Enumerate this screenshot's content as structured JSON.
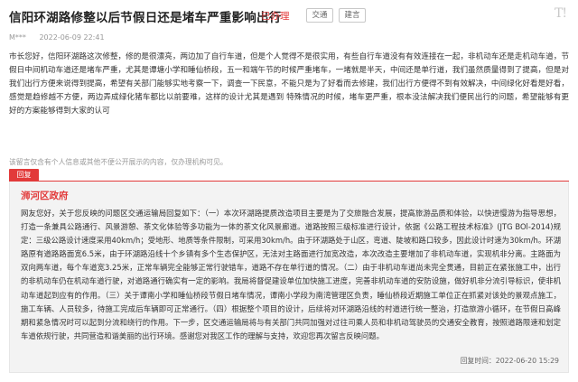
{
  "header": {
    "title": "信阳环湖路修整以后节假日还是堵车严重影响出行",
    "status": "已办理",
    "tags": [
      "交通",
      "建言"
    ],
    "logo": "T!"
  },
  "meta": {
    "user": "M***",
    "date": "2022-06-09 22:41"
  },
  "message": "市长您好，信阳环湖路这次修整，修的是很漂亮，两边加了自行车道，但是个人觉得不是很实用，有些自行车道没有有效连接在一起，非机动车还是走机动车道，节假日中间机动车道还是堵车严重，尤其是谭塘小学和睡仙桥段，五一和端午节的时候严重堵车，一堵就是半天，中间还是单行道，我们虽然质量得到了提高，但是对我们出行方便来说得到提高，希望有关部门能够实地考察一下，调查一下民意，不能只是为了好看而去修建，我们出行方便得不到有效解决，中间绿化好看是好看，感觉是趋修越不方便，两边弄成绿化猪车都比以前要难，这样的设计尤其是遇到 特殊情况的时候，堵车更严重，根本没法解决我们便民出行的问题，希望能够有更好的方案能够得到大家的认可",
  "notice": "该留言仅含有个人信息或其他不便公开展示的内容，仅办理机构可见。",
  "reply": {
    "tab_label": "回复",
    "org": "浉河区政府",
    "text": "网友您好，关于您反映的问题区交通运输局回复如下：（一）本次环湖路提质改造项目主要是为了交旅融合发展，提高旅游品质和体验，以快进慢游为指导思想，打造一条兼具公路通行、风景游憩、茶文化体验等多功能为一体的茶文化风景廊道。道路按照三级标准进行设计，依据《公路工程技术标准》(JTG BOl-2014)规定：三级公路设计速度采用40km/h；受地形、地质等条件限制，可采用30km/h。由于环湖路处于山区，弯道、陡坡和路口较多，因此设计时速为30km/h。环湖路原有道路路面宽6.5米，由于环湖路沿线十个乡镇有多个生态保护区，无法对主路面进行加宽改造，本次改造主要增加了非机动车道，实现机非分离。主路面为双向两车道，每个车道宽3.25米，正常车辆完全能够正常行驶错车，道路不存在单行道的情况。（二）由于非机动车道尚未完全贯通，目前正在紧张施工中，出行的非机动车仍在机动车道行驶，对道路通行确实有一定的影响。我局将督促建设单位加快施工进度，完善非机动车道的安防设施，做好机非分流引导标识，使非机动车道起到应有的作用。（三）关于谭南小学和睡仙桥段节假日堵车情况，谭南小学段为南湾管理区负责，睡仙桥段近期施工单位正在抓紧对该处的景观点施工，施工车辆、人员较多，待施工完成后车辆即可正常通行。（四）根据整个项目的设计，后续将对环湖路沿线的村道进行统一整治，打造旅游小循环，在节假日高峰期和紧急情况时可以起到分流和绕行的作用。下一步，区交通运输局将与有关部门共同加强对过往司乘人员和非机动驾驶员的交通安全教育，按照道路限速和划定车道依规行驶，共同营造和谐美丽的出行环境。感谢您对我区工作的理解与支持，欢迎您再次留言反映问题。",
    "time": "回复时间：2022-06-20 15:29"
  }
}
